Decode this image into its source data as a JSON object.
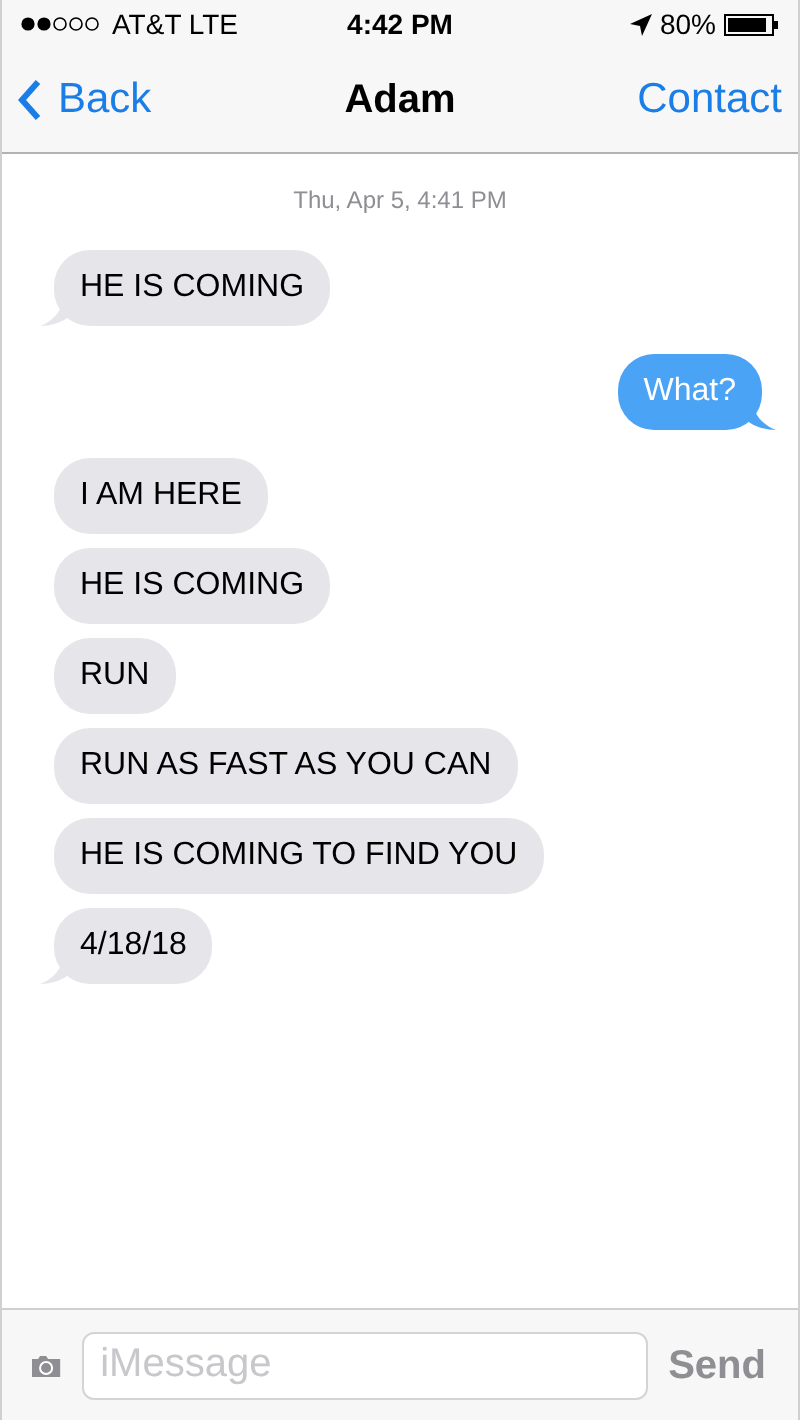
{
  "status_bar": {
    "carrier": "AT&T LTE",
    "time": "4:42 PM",
    "battery": "80%"
  },
  "nav": {
    "back": "Back",
    "title": "Adam",
    "action": "Contact"
  },
  "timestamp": "Thu, Apr 5, 4:41 PM",
  "messages": [
    {
      "kind": "received",
      "text": "HE IS COMING",
      "tail": true
    },
    {
      "kind": "sent",
      "text": "What?",
      "tail": true
    },
    {
      "kind": "received",
      "text": "I AM HERE",
      "tail": false
    },
    {
      "kind": "received",
      "text": "HE IS COMING",
      "tail": false
    },
    {
      "kind": "received",
      "text": "RUN",
      "tail": false
    },
    {
      "kind": "received",
      "text": "RUN AS FAST AS YOU CAN",
      "tail": false
    },
    {
      "kind": "received",
      "text": "HE IS COMING TO FIND YOU",
      "tail": false
    },
    {
      "kind": "received",
      "text": "4/18/18",
      "tail": true
    }
  ],
  "composer": {
    "placeholder": "iMessage",
    "send": "Send"
  }
}
